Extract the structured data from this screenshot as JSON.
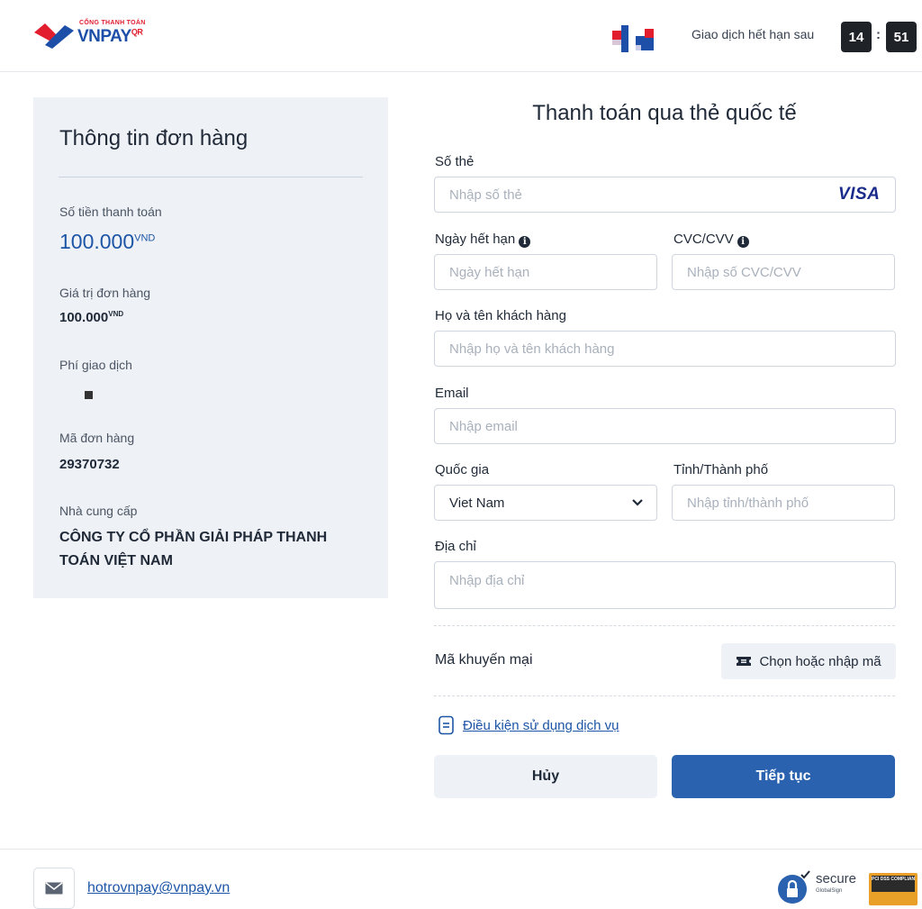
{
  "header": {
    "logo_top": "CỔNG THANH TOÁN",
    "logo_main": "VNPAY",
    "logo_suffix": "QR",
    "expire_label": "Giao dịch hết hạn sau",
    "timer_minutes": "14",
    "timer_separator": ":",
    "timer_seconds": "51"
  },
  "order": {
    "title": "Thông tin đơn hàng",
    "amount_label": "Số tiền thanh toán",
    "amount_value": "100.000",
    "amount_currency": "VND",
    "order_value_label": "Giá trị đơn hàng",
    "order_value": "100.000",
    "order_value_currency": "VND",
    "fee_label": "Phí giao dịch",
    "order_id_label": "Mã đơn hàng",
    "order_id": "29370732",
    "provider_label": "Nhà cung cấp",
    "provider_name": "CÔNG TY CỔ PHẦN GIẢI PHÁP THANH TOÁN VIỆT NAM"
  },
  "form": {
    "title": "Thanh toán qua thẻ quốc tế",
    "card_number_label": "Số thẻ",
    "card_number_placeholder": "Nhập số thẻ",
    "card_brand": "VISA",
    "expiry_label": "Ngày hết hạn",
    "expiry_placeholder": "Ngày hết hạn",
    "cvc_label": "CVC/CVV",
    "cvc_placeholder": "Nhập số CVC/CVV",
    "info_glyph": "i",
    "name_label": "Họ và tên khách hàng",
    "name_placeholder": "Nhập họ và tên khách hàng",
    "email_label": "Email",
    "email_placeholder": "Nhập email",
    "country_label": "Quốc gia",
    "country_value": "Viet Nam",
    "city_label": "Tỉnh/Thành phố",
    "city_placeholder": "Nhập tỉnh/thành phố",
    "address_label": "Địa chỉ",
    "address_placeholder": "Nhập địa chỉ",
    "promo_label": "Mã khuyến mại",
    "promo_button": "Chọn hoặc nhập mã",
    "terms_link": "Điều kiện sử dụng dịch vụ",
    "cancel_button": "Hủy",
    "continue_button": "Tiếp tục"
  },
  "footer": {
    "support_email": "hotrovnpay@vnpay.vn",
    "secure_text": "secure",
    "secure_sub": "GlobalSign",
    "pci_text": "PCI DSS COMPLIANT"
  },
  "colors": {
    "brand_blue": "#1d56a6",
    "primary_button": "#2a62b0",
    "panel_bg": "#eef1f6",
    "brand_red": "#e11d2e"
  },
  "icons": {
    "logo": "vnpay-logo-icon",
    "flag": "flag-icon",
    "info": "info-icon",
    "chevron": "chevron-down-icon",
    "ticket": "ticket-icon",
    "document": "document-icon",
    "mail": "mail-icon",
    "lock": "lock-icon"
  }
}
